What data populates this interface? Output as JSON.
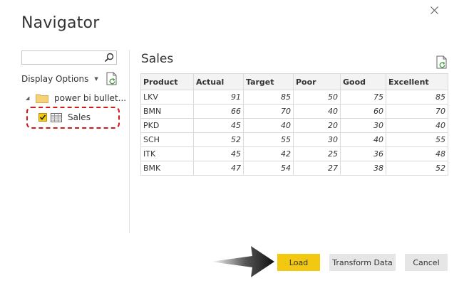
{
  "window": {
    "title": "Navigator",
    "close_icon": "close-icon"
  },
  "left_pane": {
    "search": {
      "value": "",
      "placeholder": "",
      "icon": "search-icon"
    },
    "display_options_label": "Display Options",
    "refresh_icon": "refresh-document-icon",
    "tree": {
      "folder_label": "power bi bullet...",
      "folder_icon": "folder-icon",
      "items": [
        {
          "label": "Sales",
          "checked": true,
          "icon": "table-icon"
        }
      ]
    }
  },
  "preview": {
    "title": "Sales",
    "refresh_icon": "refresh-document-icon",
    "columns": [
      "Product",
      "Actual",
      "Target",
      "Poor",
      "Good",
      "Excellent"
    ],
    "rows": [
      [
        "LKV",
        "91",
        "85",
        "50",
        "75",
        "85"
      ],
      [
        "BMN",
        "66",
        "70",
        "40",
        "60",
        "70"
      ],
      [
        "PKD",
        "45",
        "40",
        "20",
        "30",
        "40"
      ],
      [
        "SCH",
        "52",
        "55",
        "30",
        "40",
        "55"
      ],
      [
        "ITK",
        "45",
        "42",
        "25",
        "36",
        "48"
      ],
      [
        "BMK",
        "47",
        "54",
        "27",
        "38",
        "52"
      ]
    ]
  },
  "footer": {
    "load_label": "Load",
    "transform_label": "Transform Data",
    "cancel_label": "Cancel"
  },
  "colors": {
    "accent": "#f2c811",
    "annotation_red": "#d31a1a",
    "button_gray": "#e6e6e6"
  }
}
